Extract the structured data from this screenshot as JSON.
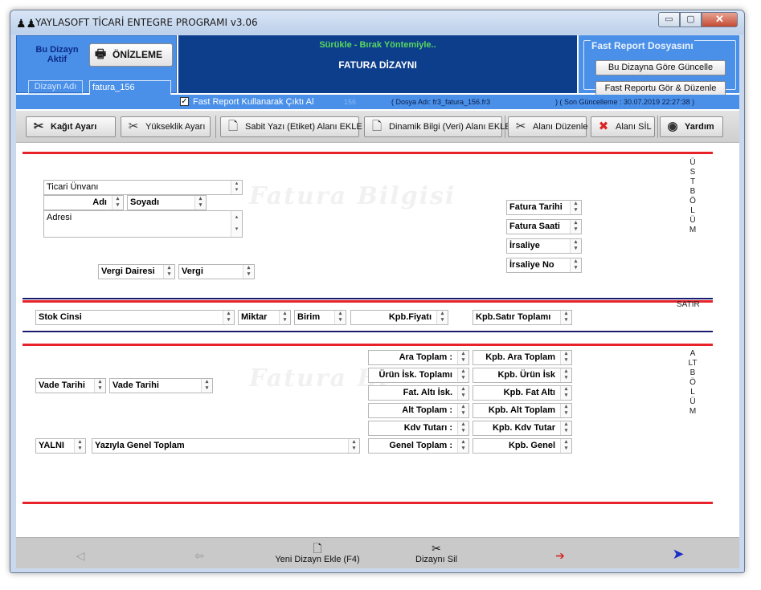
{
  "window": {
    "title": "YAYLASOFT TİCARİ ENTEGRE PROGRAMI v3.06",
    "minimize": "▭",
    "maximize": "▢",
    "close": "✕"
  },
  "header": {
    "design_active": "Bu Dizayn Aktif",
    "preview_label": "ÖNİZLEME",
    "design_name_label": "Dizayn Adı",
    "design_name_value": "fatura_156",
    "drag_drop_text": "Sürükle - Bırak Yöntemiyle..",
    "design_title": "FATURA DİZAYNI",
    "fast_report_group": "Fast Report Dosyasını",
    "update_button": "Bu Dizayna Göre Güncelle",
    "view_edit_button": "Fast Reportu Gör & Düzenle"
  },
  "info_strip": {
    "use_fast_report_checked": true,
    "use_fast_report_label": "Fast Report Kullanarak Çıktı Al",
    "design_number": "156",
    "file_name": "( Dosya Adı: fr3_fatura_156.fr3",
    "last_update": ")  ( Son Güncelleme : 30.07.2019     22:27:38    )"
  },
  "toolbar": {
    "paper_settings": "Kağıt Ayarı",
    "height_settings": "Yükseklik Ayarı",
    "add_static_text": "Sabit Yazı (Etiket) Alanı EKLE",
    "add_dynamic_info": "Dinamik Bilgi (Veri) Alanı EKLE",
    "edit_field": "Alanı Düzenle",
    "delete_field": "Alanı SİL",
    "help": "Yardım"
  },
  "canvas": {
    "watermark_top": "Fatura Bilgisi",
    "watermark_bottom": "Fatura Bi",
    "top_section_label": "ÜST BÖLÜM",
    "line_section_label": "SATIR",
    "bottom_section_label": "ALT BÖLÜM",
    "top_fields": {
      "ticari_unvani": "Ticari Ünvanı",
      "adi": "Adı",
      "soyadi": "Soyadı",
      "adresi": "Adresi",
      "vergi_dairesi": "Vergi Dairesi",
      "vergi": "Vergi",
      "fatura_tarihi": "Fatura Tarihi",
      "fatura_saati": "Fatura Saati",
      "irsaliye": "İrsaliye",
      "irsaliye_no": "İrsaliye No"
    },
    "line_fields": {
      "stok_cinsi": "Stok Cinsi",
      "miktar": "Miktar",
      "birim": "Birim",
      "kpb_fiyati": "Kpb.Fiyatı",
      "kpb_satir_toplami": "Kpb.Satır Toplamı"
    },
    "bottom_fields": {
      "ara_toplam": "Ara Toplam :",
      "kpb_ara_toplam": "Kpb. Ara Toplam",
      "urun_isk_toplami": "Ürün İsk. Toplamı",
      "kpb_urun_isk": "Kpb. Ürün İsk",
      "fat_alti_isk": "Fat. Altı İsk.",
      "kpb_fat_alti": "Kpb. Fat Altı",
      "alt_toplam": "Alt Toplam :",
      "kpb_alt_toplam": "Kpb. Alt Toplam",
      "kdv_tutari": "Kdv Tutarı :",
      "kpb_kdv_tutar": "Kpb. Kdv Tutar",
      "genel_toplam": "Genel Toplam :",
      "kpb_genel": "Kpb. Genel",
      "vade_tarihi_label": "Vade Tarihi",
      "vade_tarihi": "Vade Tarihi",
      "yalniz": "YALNI",
      "yaziyla_genel_toplam": "Yazıyla Genel Toplam"
    }
  },
  "bottom_nav": {
    "new_design": "Yeni Dizayn Ekle (F4)",
    "delete_design": "Dizaynı Sil"
  },
  "colors": {
    "header_blue": "#4a90e8",
    "header_dark": "#0d3e8c",
    "drag_text_green": "#58d85e",
    "section_red": "#e8222a"
  }
}
